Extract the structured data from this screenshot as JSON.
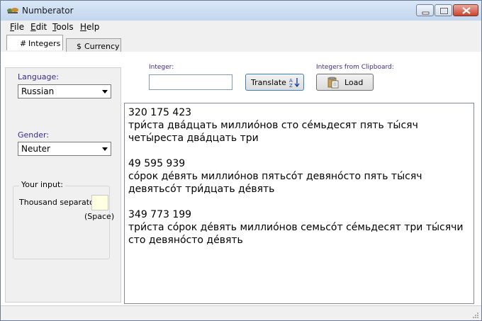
{
  "window": {
    "title": "Numberator"
  },
  "menu": [
    {
      "key": "F",
      "rest": "ile"
    },
    {
      "key": "E",
      "rest": "dit"
    },
    {
      "key": "T",
      "rest": "ools"
    },
    {
      "key": "H",
      "rest": "elp"
    }
  ],
  "tabs": [
    {
      "icon": "#",
      "label": "Integers"
    },
    {
      "icon": "$",
      "label": "Currency"
    }
  ],
  "left": {
    "language_label": "Language:",
    "language_value": "Russian",
    "gender_label": "Gender:",
    "gender_value": "Neuter",
    "your_input": "Your input:",
    "thousand_sep_label": "Thousand separator:",
    "thousand_sep_value": "",
    "space_hint": "(Space)"
  },
  "top": {
    "integer_label": "Integer:",
    "integer_value": "",
    "translate_label": "Translate",
    "clipboard_label": "Integers from Clipboard:",
    "load_label": "Load"
  },
  "results": [
    {
      "number": "320 175 423",
      "words": "три́ста два́дцать миллио́нов сто се́мьдесят пять ты́сяч четы́реста два́дцать три"
    },
    {
      "number": "49 595 939",
      "words": "со́рок де́вять миллио́нов пятьсо́т девяно́сто пять ты́сяч девятьсо́т три́дцать де́вять"
    },
    {
      "number": "349 773 199",
      "words": "три́ста со́рок де́вять миллио́нов семьсо́т се́мьдесят три ты́сячи сто девяно́сто де́вять"
    }
  ],
  "colors": {
    "label_purple": "#3c2a8c",
    "input_yellow": "#ffffe1"
  }
}
